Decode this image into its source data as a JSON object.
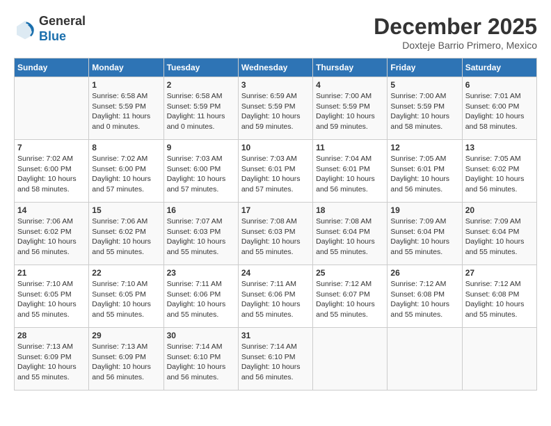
{
  "header": {
    "logo_general": "General",
    "logo_blue": "Blue",
    "title": "December 2025",
    "subtitle": "Doxteje Barrio Primero, Mexico"
  },
  "weekdays": [
    "Sunday",
    "Monday",
    "Tuesday",
    "Wednesday",
    "Thursday",
    "Friday",
    "Saturday"
  ],
  "weeks": [
    [
      {
        "day": "",
        "info": ""
      },
      {
        "day": "1",
        "info": "Sunrise: 6:58 AM\nSunset: 5:59 PM\nDaylight: 11 hours\nand 0 minutes."
      },
      {
        "day": "2",
        "info": "Sunrise: 6:58 AM\nSunset: 5:59 PM\nDaylight: 11 hours\nand 0 minutes."
      },
      {
        "day": "3",
        "info": "Sunrise: 6:59 AM\nSunset: 5:59 PM\nDaylight: 10 hours\nand 59 minutes."
      },
      {
        "day": "4",
        "info": "Sunrise: 7:00 AM\nSunset: 5:59 PM\nDaylight: 10 hours\nand 59 minutes."
      },
      {
        "day": "5",
        "info": "Sunrise: 7:00 AM\nSunset: 5:59 PM\nDaylight: 10 hours\nand 58 minutes."
      },
      {
        "day": "6",
        "info": "Sunrise: 7:01 AM\nSunset: 6:00 PM\nDaylight: 10 hours\nand 58 minutes."
      }
    ],
    [
      {
        "day": "7",
        "info": "Sunrise: 7:02 AM\nSunset: 6:00 PM\nDaylight: 10 hours\nand 58 minutes."
      },
      {
        "day": "8",
        "info": "Sunrise: 7:02 AM\nSunset: 6:00 PM\nDaylight: 10 hours\nand 57 minutes."
      },
      {
        "day": "9",
        "info": "Sunrise: 7:03 AM\nSunset: 6:00 PM\nDaylight: 10 hours\nand 57 minutes."
      },
      {
        "day": "10",
        "info": "Sunrise: 7:03 AM\nSunset: 6:01 PM\nDaylight: 10 hours\nand 57 minutes."
      },
      {
        "day": "11",
        "info": "Sunrise: 7:04 AM\nSunset: 6:01 PM\nDaylight: 10 hours\nand 56 minutes."
      },
      {
        "day": "12",
        "info": "Sunrise: 7:05 AM\nSunset: 6:01 PM\nDaylight: 10 hours\nand 56 minutes."
      },
      {
        "day": "13",
        "info": "Sunrise: 7:05 AM\nSunset: 6:02 PM\nDaylight: 10 hours\nand 56 minutes."
      }
    ],
    [
      {
        "day": "14",
        "info": "Sunrise: 7:06 AM\nSunset: 6:02 PM\nDaylight: 10 hours\nand 56 minutes."
      },
      {
        "day": "15",
        "info": "Sunrise: 7:06 AM\nSunset: 6:02 PM\nDaylight: 10 hours\nand 55 minutes."
      },
      {
        "day": "16",
        "info": "Sunrise: 7:07 AM\nSunset: 6:03 PM\nDaylight: 10 hours\nand 55 minutes."
      },
      {
        "day": "17",
        "info": "Sunrise: 7:08 AM\nSunset: 6:03 PM\nDaylight: 10 hours\nand 55 minutes."
      },
      {
        "day": "18",
        "info": "Sunrise: 7:08 AM\nSunset: 6:04 PM\nDaylight: 10 hours\nand 55 minutes."
      },
      {
        "day": "19",
        "info": "Sunrise: 7:09 AM\nSunset: 6:04 PM\nDaylight: 10 hours\nand 55 minutes."
      },
      {
        "day": "20",
        "info": "Sunrise: 7:09 AM\nSunset: 6:04 PM\nDaylight: 10 hours\nand 55 minutes."
      }
    ],
    [
      {
        "day": "21",
        "info": "Sunrise: 7:10 AM\nSunset: 6:05 PM\nDaylight: 10 hours\nand 55 minutes."
      },
      {
        "day": "22",
        "info": "Sunrise: 7:10 AM\nSunset: 6:05 PM\nDaylight: 10 hours\nand 55 minutes."
      },
      {
        "day": "23",
        "info": "Sunrise: 7:11 AM\nSunset: 6:06 PM\nDaylight: 10 hours\nand 55 minutes."
      },
      {
        "day": "24",
        "info": "Sunrise: 7:11 AM\nSunset: 6:06 PM\nDaylight: 10 hours\nand 55 minutes."
      },
      {
        "day": "25",
        "info": "Sunrise: 7:12 AM\nSunset: 6:07 PM\nDaylight: 10 hours\nand 55 minutes."
      },
      {
        "day": "26",
        "info": "Sunrise: 7:12 AM\nSunset: 6:08 PM\nDaylight: 10 hours\nand 55 minutes."
      },
      {
        "day": "27",
        "info": "Sunrise: 7:12 AM\nSunset: 6:08 PM\nDaylight: 10 hours\nand 55 minutes."
      }
    ],
    [
      {
        "day": "28",
        "info": "Sunrise: 7:13 AM\nSunset: 6:09 PM\nDaylight: 10 hours\nand 55 minutes."
      },
      {
        "day": "29",
        "info": "Sunrise: 7:13 AM\nSunset: 6:09 PM\nDaylight: 10 hours\nand 56 minutes."
      },
      {
        "day": "30",
        "info": "Sunrise: 7:14 AM\nSunset: 6:10 PM\nDaylight: 10 hours\nand 56 minutes."
      },
      {
        "day": "31",
        "info": "Sunrise: 7:14 AM\nSunset: 6:10 PM\nDaylight: 10 hours\nand 56 minutes."
      },
      {
        "day": "",
        "info": ""
      },
      {
        "day": "",
        "info": ""
      },
      {
        "day": "",
        "info": ""
      }
    ]
  ]
}
